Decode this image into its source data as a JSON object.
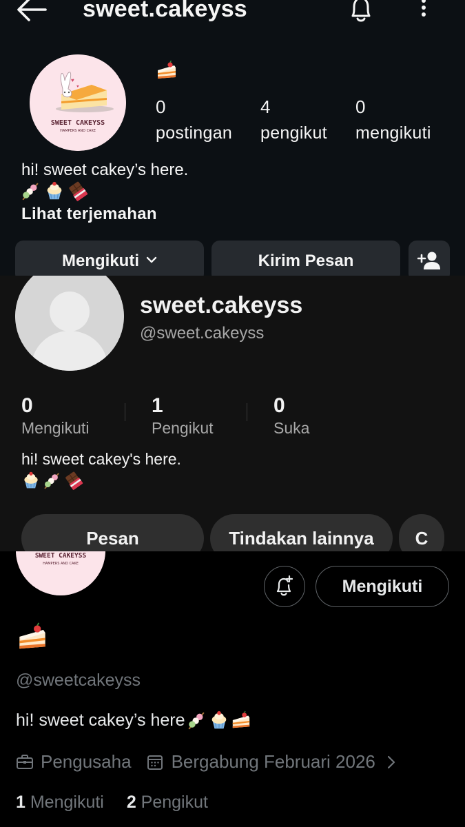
{
  "instagram": {
    "title": "sweet.cakeyss",
    "stats": [
      {
        "num": "0",
        "label": "postingan"
      },
      {
        "num": "4",
        "label": "pengikut"
      },
      {
        "num": "0",
        "label": "mengikuti"
      }
    ],
    "bio": "hi! sweet cakey’s here.",
    "translate_link": "Lihat terjemahan",
    "following_button": "Mengikuti",
    "message_button": "Kirim Pesan",
    "logo_text": "SWEET CAKEYSS",
    "logo_subtext": "HAMPERS AND CAKE",
    "icons": [
      "back-arrow-icon",
      "bell-icon",
      "more-vertical-icon",
      "chevron-down-icon",
      "add-person-icon"
    ]
  },
  "tiktok": {
    "display_name": "sweet.cakeyss",
    "handle": "@sweet.cakeyss",
    "stats": [
      {
        "num": "0",
        "label": "Mengikuti"
      },
      {
        "num": "1",
        "label": "Pengikut"
      },
      {
        "num": "0",
        "label": "Suka"
      }
    ],
    "bio": "hi! sweet cakey's here.",
    "message_button": "Pesan",
    "more_actions_button": "Tindakan lainnya",
    "partial_button": "C"
  },
  "x": {
    "follow_button": "Mengikuti",
    "handle": "@sweetcakeyss",
    "bio": "hi! sweet cakey’s here",
    "category": "Pengusaha",
    "joined": "Bergabung Februari 2026",
    "following_count": "1",
    "following_label": "Mengikuti",
    "followers_count": "2",
    "followers_label": "Pengikut",
    "logo_text": "SWEET CAKEYSS",
    "logo_subtext": "HAMPERS AND CAKE"
  },
  "colors": {
    "ig_bg": "#0c1014",
    "ig_button": "#262a2f",
    "tt_bg": "#121212",
    "tt_button": "#2f2f2f",
    "x_bg": "#000000",
    "x_secondary_text": "#71767b",
    "logo_bg": "#fce4ea",
    "logo_text": "#5a2333"
  }
}
